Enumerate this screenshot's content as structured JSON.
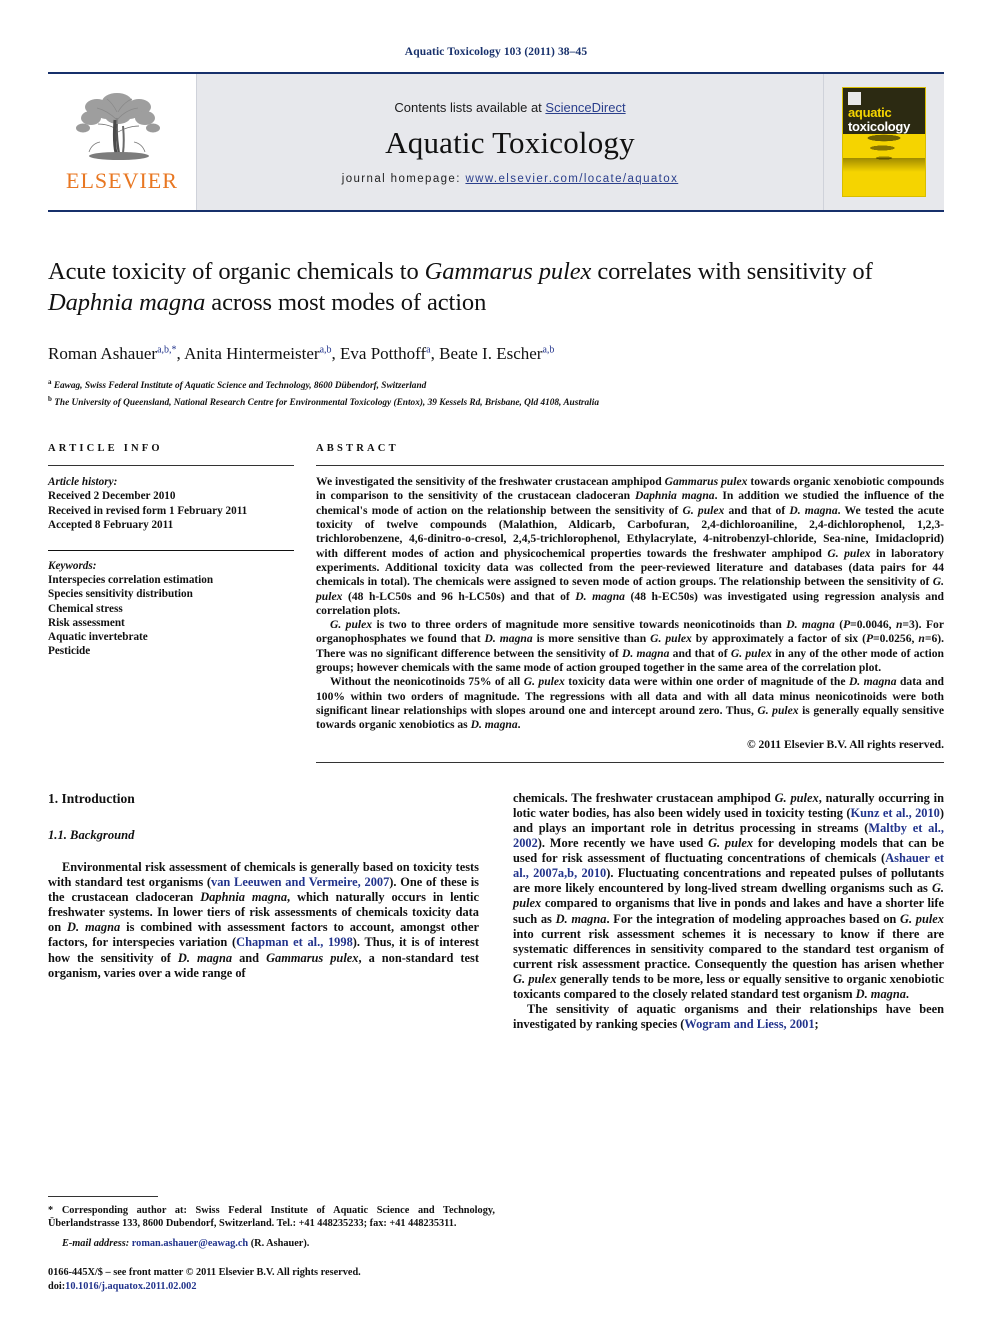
{
  "running_head": "Aquatic Toxicology 103 (2011) 38–45",
  "masthead": {
    "contents_prefix": "Contents lists available at ",
    "sciencedirect": "ScienceDirect",
    "journal_name": "Aquatic Toxicology",
    "homepage_label": "journal homepage: ",
    "homepage_url": "www.elsevier.com/locate/aquatox",
    "publisher_logo_text": "ELSEVIER",
    "cover_title_line1": "aquatic",
    "cover_title_line2": "toxicology",
    "accent_blue": "#17306b",
    "elsevier_orange": "#E87722",
    "cover_yellow": "#F5D400"
  },
  "article": {
    "title_part1": "Acute toxicity of organic chemicals to ",
    "title_italic1": "Gammarus pulex",
    "title_part2": " correlates with sensitivity of ",
    "title_italic2": "Daphnia magna",
    "title_part3": " across most modes of action",
    "authors": [
      {
        "name": "Roman Ashauer",
        "sup": "a,b,*"
      },
      {
        "name": "Anita Hintermeister",
        "sup": "a,b"
      },
      {
        "name": "Eva Potthoff",
        "sup": "a"
      },
      {
        "name": "Beate I. Escher",
        "sup": "a,b"
      }
    ],
    "affiliations": [
      {
        "sup": "a",
        "text": "Eawag, Swiss Federal Institute of Aquatic Science and Technology, 8600 Dübendorf, Switzerland"
      },
      {
        "sup": "b",
        "text": "The University of Queensland, National Research Centre for Environmental Toxicology (Entox), 39 Kessels Rd, Brisbane, Qld 4108, Australia"
      }
    ]
  },
  "article_info": {
    "heading": "ARTICLE INFO",
    "history_label": "Article history:",
    "history": [
      "Received 2 December 2010",
      "Received in revised form 1 February 2011",
      "Accepted 8 February 2011"
    ],
    "keywords_label": "Keywords:",
    "keywords": [
      "Interspecies correlation estimation",
      "Species sensitivity distribution",
      "Chemical stress",
      "Risk assessment",
      "Aquatic invertebrate",
      "Pesticide"
    ]
  },
  "abstract": {
    "heading": "ABSTRACT",
    "paragraph1_html": "We investigated the sensitivity of the freshwater crustacean amphipod <em>Gammarus pulex</em> towards organic xenobiotic compounds in comparison to the sensitivity of the crustacean cladoceran <em>Daphnia magna</em>. In addition we studied the influence of the chemical's mode of action on the relationship between the sensitivity of <em>G. pulex</em> and that of <em>D. magna</em>. We tested the acute toxicity of twelve compounds (Malathion, Aldicarb, Carbofuran, 2,4-dichloroaniline, 2,4-dichlorophenol, 1,2,3-trichlorobenzene, 4,6-dinitro-o-cresol, 2,4,5-trichlorophenol, Ethylacrylate, 4-nitrobenzyl-chloride, Sea-nine, Imidacloprid) with different modes of action and physicochemical properties towards the freshwater amphipod <em>G. pulex</em> in laboratory experiments. Additional toxicity data was collected from the peer-reviewed literature and databases (data pairs for 44 chemicals in total). The chemicals were assigned to seven mode of action groups. The relationship between the sensitivity of <em>G. pulex</em> (48 h-LC50s and 96 h-LC50s) and that of <em>D. magna</em> (48 h-EC50s) was investigated using regression analysis and correlation plots.",
    "paragraph2_html": "<em>G. pulex</em> is two to three orders of magnitude more sensitive towards neonicotinoids than <em>D. magna</em> (<em>P</em>=0.0046, <em>n</em>=3). For organophosphates we found that <em>D. magna</em> is more sensitive than <em>G. pulex</em> by approximately a factor of six (<em>P</em>=0.0256, <em>n</em>=6). There was no significant difference between the sensitivity of <em>D. magna</em> and that of <em>G. pulex</em> in any of the other mode of action groups; however chemicals with the same mode of action grouped together in the same area of the correlation plot.",
    "paragraph3_html": "Without the neonicotinoids 75% of all <em>G. pulex</em> toxicity data were within one order of magnitude of the <em>D. magna</em> data and 100% within two orders of magnitude. The regressions with all data and with all data minus neonicotinoids were both significant linear relationships with slopes around one and intercept around zero. Thus, <em>G. pulex</em> is generally equally sensitive towards organic xenobiotics as <em>D. magna</em>.",
    "copyright": "© 2011 Elsevier B.V. All rights reserved."
  },
  "body": {
    "section_heading": "1. Introduction",
    "subsection_heading": "1.1. Background",
    "left_paragraph_html": "Environmental risk assessment of chemicals is generally based on toxicity tests with standard test organisms (<a class=\"ref\" href=\"#\" data-name=\"citation-link\">van Leeuwen and Vermeire, 2007</a>). One of these is the crustacean cladoceran <em>Daphnia magna</em>, which naturally occurs in lentic freshwater systems. In lower tiers of risk assessments of chemicals toxicity data on <em>D. magna</em> is combined with assessment factors to account, amongst other factors, for interspecies variation (<a class=\"ref\" href=\"#\" data-name=\"citation-link\">Chapman et al., 1998</a>). Thus, it is of interest how the sensitivity of <em>D. magna</em> and <em>Gammarus pulex</em>, a non-standard test organism, varies over a wide range of",
    "right_paragraph1_html": "chemicals. The freshwater crustacean amphipod <em>G. pulex</em>, naturally occurring in lotic water bodies, has also been widely used in toxicity testing (<a class=\"ref\" href=\"#\" data-name=\"citation-link\">Kunz et al., 2010</a>) and plays an important role in detritus processing in streams (<a class=\"ref\" href=\"#\" data-name=\"citation-link\">Maltby et al., 2002</a>). More recently we have used <em>G. pulex</em> for developing models that can be used for risk assessment of fluctuating concentrations of chemicals (<a class=\"ref\" href=\"#\" data-name=\"citation-link\">Ashauer et al., 2007a,b, 2010</a>). Fluctuating concentrations and repeated pulses of pollutants are more likely encountered by long-lived stream dwelling organisms such as <em>G. pulex</em> compared to organisms that live in ponds and lakes and have a shorter life such as <em>D. magna</em>. For the integration of modeling approaches based on <em>G. pulex</em> into current risk assessment schemes it is necessary to know if there are systematic differences in sensitivity compared to the standard test organism of current risk assessment practice. Consequently the question has arisen whether <em>G. pulex</em> generally tends to be more, less or equally sensitive to organic xenobiotic toxicants compared to the closely related standard test organism <em>D. magna</em>.",
    "right_paragraph2_html": "The sensitivity of aquatic organisms and their relationships have been investigated by ranking species (<a class=\"ref\" href=\"#\" data-name=\"citation-link\">Wogram and Liess, 2001</a>;"
  },
  "footnotes": {
    "corresponding_html": "<span class=\"star\">*</span> Corresponding author at: Swiss Federal Institute of Aquatic Science and Technology, Überlandstrasse 133, 8600 Dubendorf, Switzerland. Tel.: +41 448235233; fax: +41 448235311.",
    "email_label": "E-mail address:",
    "email": "roman.ashauer@eawag.ch",
    "email_suffix": "(R. Ashauer).",
    "issn_line": "0166-445X/$ – see front matter © 2011 Elsevier B.V. All rights reserved.",
    "doi_label": "doi:",
    "doi": "10.1016/j.aquatox.2011.02.002"
  }
}
